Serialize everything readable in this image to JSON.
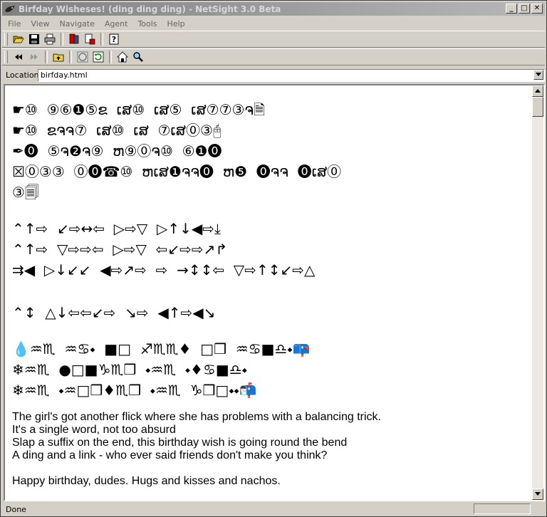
{
  "window": {
    "title": "Birfday Wisheses! (ding ding ding) - NetSight 3.0 Beta",
    "minimize": "_",
    "maximize": "□",
    "close": "✕"
  },
  "menu": [
    "File",
    "View",
    "Navigate",
    "Agent",
    "Tools",
    "Help"
  ],
  "toolbar1": [
    "open-folder-icon",
    "save-icon",
    "print-icon",
    "bookmark-icon",
    "page-info-icon",
    "help-icon"
  ],
  "toolbar2": [
    "back-icon",
    "forward-icon",
    "up-folder-icon",
    "stop-icon",
    "reload-icon",
    "home-icon",
    "search-icon"
  ],
  "location": {
    "label": "Location",
    "value": "birfday.html"
  },
  "wingdings": {
    "block1": [
      "☛⑩  ⑨⑥❶⑤ຂ  ເສ⑩  ເສ⑤  ເສ⑦⑦③ຈ🗎",
      "☛⑩  ຂຈຈ⑦  ເສ⑩  ເສ  ⑦ເສ⓪③🖰",
      "✒⓿  ⑤ຈ❷ຈ⑨  ຫ⑨⓪ຈ⑩  ⑥❶⓿",
      "☒⓪③③  ⓪⓿☎⑩  ຫເສ❶ຈຈ⓿  ຫ❺  ⓿ຈຈ  ⓿ເສ⓪",
      "③🗐"
    ],
    "block2": [
      "⌃↑⇨  ↙⇨↔⇦  ▷⇨▽  ▷↑↓◀⇨⤓",
      "⌃↑⇨  ▽⇨⇨⇦  ▷⇨▽  ⇦↙⇨⇨↗↱",
      "⇉◀  ▷↓↙↙  ◀⇨↗⇨  ⇨  →↕↕⇦  ▽⇨↑↕↙⇨△"
    ],
    "block3": [
      "⌃↕  △↓⇦⇦↙⇨  ↘⇨  ◀↑⇨◀↘"
    ],
    "block4": [
      "💧♒♏  ♒♋⬩  ■□  ♐♏♏♦  □❒  ♒♋■♎⬩📪",
      "❄♒♏  ●□■♑♏❒  ⬩♒♏  ⬩♦♋■♎⬩",
      "❄♒♏  ⬩♒□❒♦♏❒  ⬩♒♏  ♑❒□⬩⬩📬"
    ]
  },
  "poem": [
    "The girl's got another flick where she has problems with a balancing trick.",
    "It's a single word, not too absurd",
    "Slap a suffix on the end, this birthday wish is going round the bend",
    "A ding and a link - who ever said friends don't make you think?"
  ],
  "closing": "Happy birthday, dudes. Hugs and kisses and nachos.",
  "status": {
    "text": "Done"
  }
}
